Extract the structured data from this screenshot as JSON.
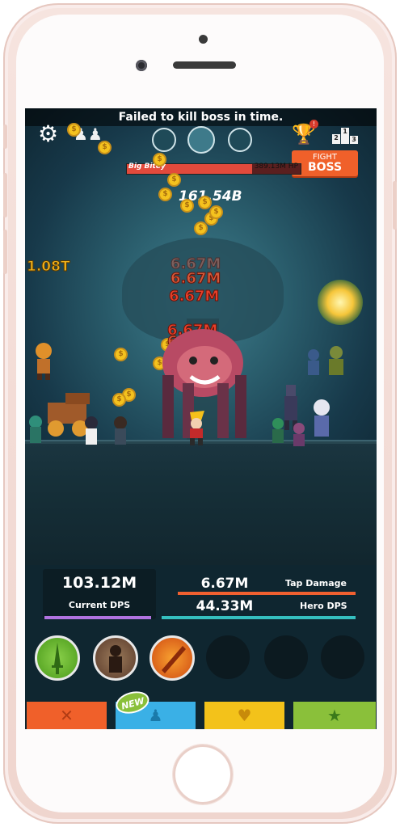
{
  "top_message": "Failed to kill boss in time.",
  "trophy_badge": "!",
  "leaderboard_ranks": [
    "2",
    "1",
    "3"
  ],
  "boss": {
    "name": "Big Bitey",
    "hp_text": "389.13M HP",
    "hp_fraction": 0.72,
    "fight_label_top": "FIGHT",
    "fight_label_bottom": "BOSS"
  },
  "gold_earned": "161.54B",
  "offscreen_damage": "1.08T",
  "damage_numbers": [
    "6.67M",
    "6.67M",
    "6.67M",
    "6.67M",
    "6.67M"
  ],
  "stats": {
    "current_dps_value": "103.12M",
    "current_dps_label": "Current DPS",
    "tap_damage_value": "6.67M",
    "tap_damage_label": "Tap Damage",
    "hero_dps_value": "44.33M",
    "hero_dps_label": "Hero DPS"
  },
  "skills": [
    {
      "name": "heavenly-strike-skill",
      "color": "#5fae2b"
    },
    {
      "name": "shadow-clone-skill",
      "color": "#7a5a44"
    },
    {
      "name": "war-cry-skill",
      "color": "#e8561e"
    }
  ],
  "tabs": [
    {
      "icon": "crossed-swords-icon",
      "glyph": "✕",
      "color": "#f0602a"
    },
    {
      "icon": "heroes-icon",
      "glyph": "♟",
      "color": "#3ab0e6"
    },
    {
      "icon": "heart-icon",
      "glyph": "♥",
      "color": "#f3c21a"
    },
    {
      "icon": "star-icon",
      "glyph": "★",
      "color": "#8ac03a"
    }
  ],
  "new_badge": "NEW"
}
